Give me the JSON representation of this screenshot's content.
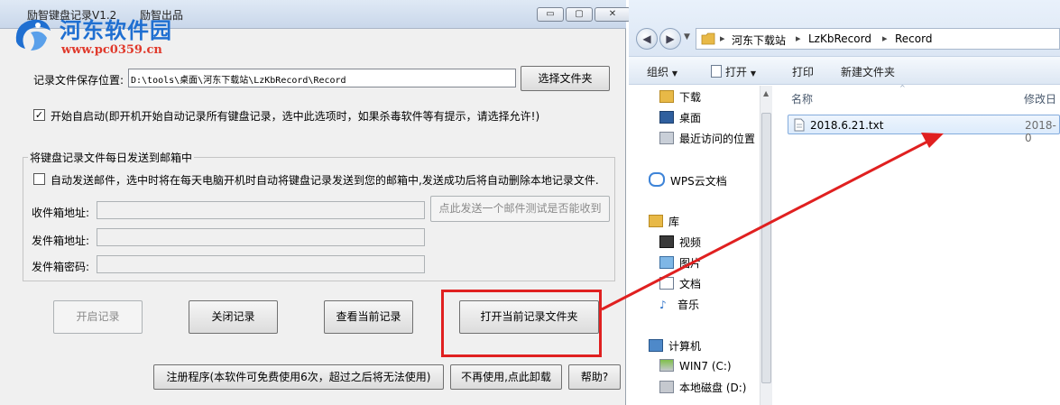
{
  "app": {
    "title": "励智键盘记录V1.2",
    "publisher": "励智出品",
    "controls": {
      "minimize": "▭",
      "maximize": "▢",
      "close": "✕"
    },
    "watermark": {
      "name": "河东软件园",
      "url": "www.pc0359.cn"
    },
    "save_location": {
      "label": "记录文件保存位置:",
      "value": "D:\\tools\\桌面\\河东下载站\\LzKbRecord\\Record",
      "choose_button": "选择文件夹"
    },
    "autostart": {
      "checked": true,
      "label": "开始自启动(即开机开始自动记录所有键盘记录，选中此选项时，如果杀毒软件等有提示，请选择允许!)"
    },
    "email_group": {
      "title": "将键盘记录文件每日发送到邮箱中",
      "auto_send": {
        "checked": false,
        "label": "自动发送邮件，选中时将在每天电脑开机时自动将键盘记录发送到您的邮箱中,发送成功后将自动删除本地记录文件."
      },
      "receive_label": "收件箱地址:",
      "send_label": "发件箱地址:",
      "password_label": "发件箱密码:",
      "receive_value": "",
      "send_value": "",
      "password_value": "",
      "test_button": "点此发送一个邮件测试是否能收到"
    },
    "buttons": {
      "start": "开启记录",
      "stop": "关闭记录",
      "view": "查看当前记录",
      "open_folder": "打开当前记录文件夹",
      "register": "注册程序(本软件可免费使用6次，超过之后将无法使用)",
      "uninstall": "不再使用,点此卸载",
      "help": "帮助?"
    }
  },
  "explorer": {
    "breadcrumb": [
      "河东下载站",
      "LzKbRecord",
      "Record"
    ],
    "toolbar": {
      "organize": "组织",
      "open": "打开",
      "print": "打印",
      "new_folder": "新建文件夹"
    },
    "nav": {
      "downloads": "下载",
      "desktop": "桌面",
      "recent": "最近访问的位置",
      "wps_cloud": "WPS云文档",
      "libraries": "库",
      "videos": "视频",
      "pictures": "图片",
      "documents": "文档",
      "music": "音乐",
      "computer": "计算机",
      "drive_c": "WIN7 (C:)",
      "drive_d": "本地磁盘 (D:)"
    },
    "columns": {
      "name": "名称",
      "modified": "修改日"
    },
    "files": [
      {
        "name": "2018.6.21.txt",
        "date": "2018-0"
      }
    ]
  },
  "colors": {
    "highlight": "#e02020",
    "arrow": "#e02020",
    "watermark_blue": "#1f6fd1",
    "watermark_red": "#e0392b"
  }
}
